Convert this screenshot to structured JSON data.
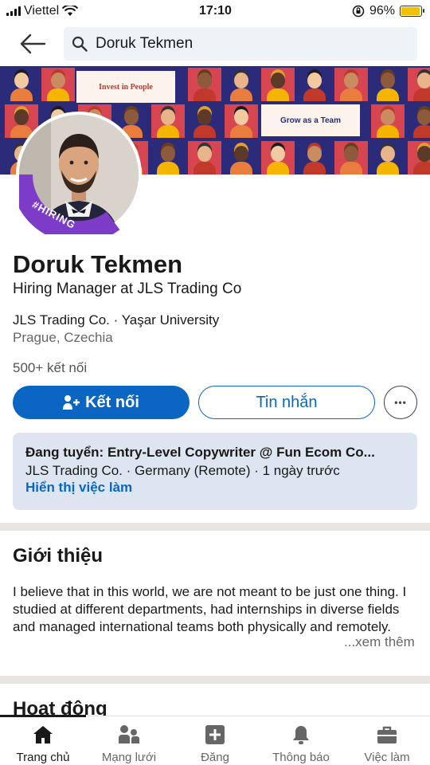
{
  "status_bar": {
    "carrier": "Viettel",
    "time": "17:10",
    "battery": "96%",
    "battery_level": 0.96
  },
  "search": {
    "query": "Doruk Tekmen"
  },
  "banner": {
    "text1": "Invest in People",
    "text2": "Grow as a Team"
  },
  "profile": {
    "badge": "#HIRING",
    "name": "Doruk Tekmen",
    "headline": "Hiring Manager at JLS Trading Co",
    "organizations": "JLS Trading Co. · Yaşar University",
    "location": "Prague, Czechia",
    "connections": "500+ kết nối"
  },
  "actions": {
    "connect": "Kết nối",
    "message": "Tin nhắn",
    "more": "•••"
  },
  "job": {
    "title": "Đang tuyển: Entry-Level Copywriter @ Fun Ecom Co...",
    "details": "JLS Trading Co. · Germany (Remote) · 1 ngày trước",
    "link": "Hiển thị việc làm"
  },
  "about": {
    "title": "Giới thiệu",
    "text": "I believe that in this world, we are not meant to be just one thing. I studied at different departments, had internships in diverse fields and managed international teams both physically and remotely.",
    "see_more": "...xem thêm"
  },
  "activity": {
    "title": "Hoạt động"
  },
  "nav": [
    {
      "label": "Trang chủ",
      "icon": "home-icon"
    },
    {
      "label": "Mạng lưới",
      "icon": "network-icon"
    },
    {
      "label": "Đăng",
      "icon": "post-icon"
    },
    {
      "label": "Thông báo",
      "icon": "bell-icon"
    },
    {
      "label": "Việc làm",
      "icon": "briefcase-icon"
    }
  ],
  "colors": {
    "brand": "#0a66c2",
    "banner_navy": "#2b2b7a",
    "banner_red": "#d64550",
    "hiring_purple": "#7d3cc8"
  }
}
